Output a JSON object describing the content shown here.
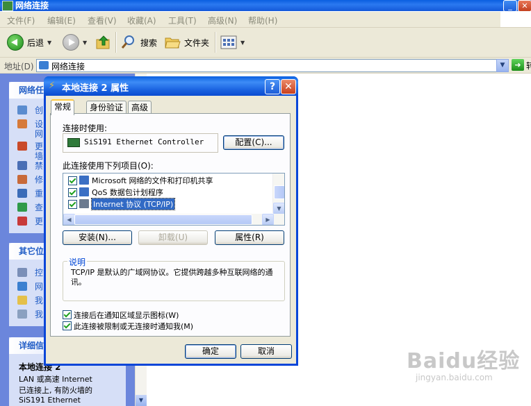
{
  "window": {
    "title": "网络连接",
    "minimize": "_",
    "close": "✕"
  },
  "menu": [
    "文件(F)",
    "编辑(E)",
    "查看(V)",
    "收藏(A)",
    "工具(T)",
    "高级(N)",
    "帮助(H)"
  ],
  "toolbar": {
    "back": "后退",
    "search": "搜索",
    "folders": "文件夹"
  },
  "address": {
    "label": "地址(D)",
    "value": "网络连接",
    "go": "转"
  },
  "sidebar": {
    "tasks_title": "网络任",
    "tasks": [
      "创",
      "设",
      "网",
      "更",
      "墙",
      "禁",
      "修",
      "重",
      "查",
      "更"
    ],
    "other_title": "其它位",
    "other": [
      "控",
      "网",
      "我",
      "我"
    ],
    "details_title": "详细信",
    "details_name": "本地连接 2",
    "details_lines": [
      "LAN 或高速 Internet",
      "已连接上, 有防火墙的",
      "SiS191 Ethernet"
    ]
  },
  "dialog": {
    "title": "本地连接 2 属性",
    "help": "?",
    "close": "✕",
    "tabs": [
      "常规",
      "身份验证",
      "高级"
    ],
    "connect_using_label": "连接时使用:",
    "adapter": "SiS191 Ethernet Controller",
    "configure_button": "配置(C)...",
    "items_label": "此连接使用下列项目(O):",
    "items": [
      {
        "label": "Microsoft 网络的文件和打印机共享",
        "checked": true
      },
      {
        "label": "QoS 数据包计划程序",
        "checked": true
      },
      {
        "label": "Internet 协议 (TCP/IP)",
        "checked": true,
        "selected": true
      }
    ],
    "install_button": "安装(N)...",
    "uninstall_button": "卸载(U)",
    "properties_button": "属性(R)",
    "description_title": "说明",
    "description_text": "TCP/IP 是默认的广域网协议。它提供跨越多种互联网络的通讯。",
    "show_icon_label": "连接后在通知区域显示图标(W)",
    "notify_label": "此连接被限制或无连接时通知我(M)",
    "ok_button": "确定",
    "cancel_button": "取消"
  },
  "watermark": {
    "brand": "Baidu经验",
    "url": "jingyan.baidu.com"
  }
}
